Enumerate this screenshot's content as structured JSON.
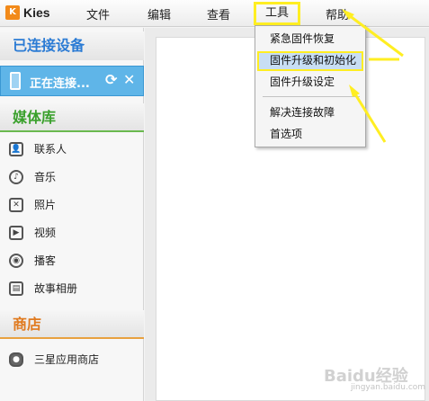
{
  "app": {
    "title": "Kies",
    "logo_text": "K"
  },
  "menu": {
    "file": "文件",
    "edit": "编辑",
    "view": "查看",
    "tools": "工具",
    "help": "帮助"
  },
  "sidebar": {
    "connected_header": "已连接设备",
    "device_label": "正在连接...",
    "media_header": "媒体库",
    "media_items": [
      {
        "label": "联系人",
        "icon": "contacts-icon"
      },
      {
        "label": "音乐",
        "icon": "music-icon"
      },
      {
        "label": "照片",
        "icon": "photo-icon"
      },
      {
        "label": "视频",
        "icon": "video-icon"
      },
      {
        "label": "播客",
        "icon": "podcast-icon"
      },
      {
        "label": "故事相册",
        "icon": "story-album-icon"
      }
    ],
    "store_header": "商店",
    "store_items": [
      {
        "label": "三星应用商店",
        "icon": "samsung-apps-icon"
      }
    ]
  },
  "tools_menu": {
    "items": [
      "紧急固件恢复",
      "固件升级和初始化",
      "固件升级设定",
      "解决连接故障",
      "首选项"
    ],
    "selected_index": 1
  },
  "colors": {
    "highlight": "#ffee22",
    "device_selected": "#5fb5e8",
    "header_blue": "#2b7bd4",
    "header_green": "#3aa02c",
    "header_orange": "#e07a1f"
  },
  "watermark": {
    "text": "Baidu经验",
    "sub": "jingyan.baidu.com"
  }
}
